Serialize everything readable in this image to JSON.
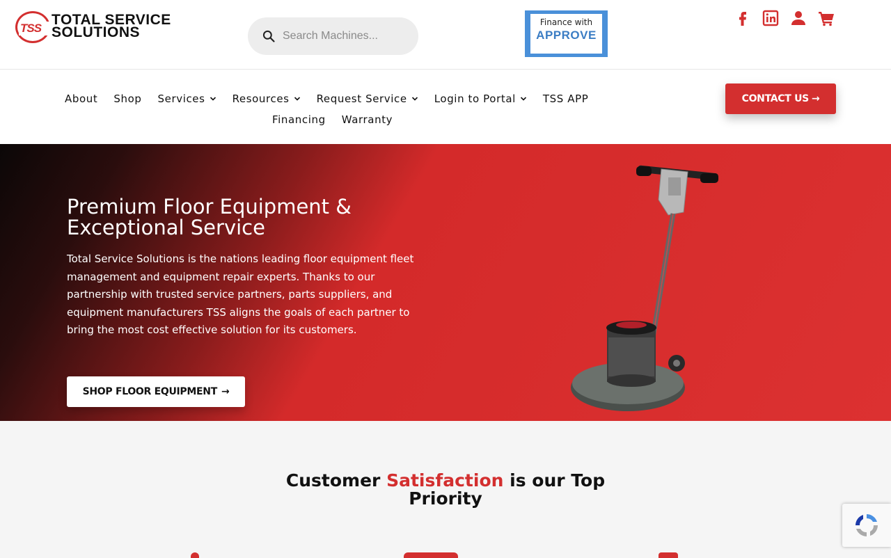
{
  "header": {
    "logo": {
      "mark": "TSS",
      "line1": "TOTAL SERVICE",
      "line2": "SOLUTIONS"
    },
    "search": {
      "placeholder": "Search Machines..."
    },
    "finance": {
      "small": "Finance with",
      "brand": "APPROVE"
    },
    "social": [
      "facebook-icon",
      "linkedin-icon",
      "user-icon",
      "cart-icon"
    ]
  },
  "nav": {
    "row1": [
      {
        "label": "About",
        "dropdown": false
      },
      {
        "label": "Shop",
        "dropdown": false
      },
      {
        "label": "Services",
        "dropdown": true
      },
      {
        "label": "Resources",
        "dropdown": true
      },
      {
        "label": "Request Service",
        "dropdown": true
      },
      {
        "label": "Login to Portal",
        "dropdown": true
      },
      {
        "label": "TSS APP",
        "dropdown": false
      }
    ],
    "row2": [
      {
        "label": "Financing",
        "dropdown": false
      },
      {
        "label": "Warranty",
        "dropdown": false
      }
    ],
    "contact_label": "CONTACT US",
    "arrow": "→"
  },
  "hero": {
    "title": "Premium Floor Equipment & Exceptional Service",
    "body": "Total Service Solutions is the nations leading floor equipment fleet management and equipment repair experts. Thanks to our partnership with trusted service partners, parts suppliers, and equipment manufacturers TSS aligns the goals of each partner to bring the most cost effective solution for its customers.",
    "cta_label": "SHOP FLOOR EQUIPMENT",
    "arrow": "→"
  },
  "section": {
    "title_pre": "Customer ",
    "title_accent": "Satisfaction",
    "title_post": " is our Top",
    "title_line2": "Priority"
  },
  "colors": {
    "brand_red": "#d32f2f",
    "finance_blue": "#4a90d9"
  }
}
